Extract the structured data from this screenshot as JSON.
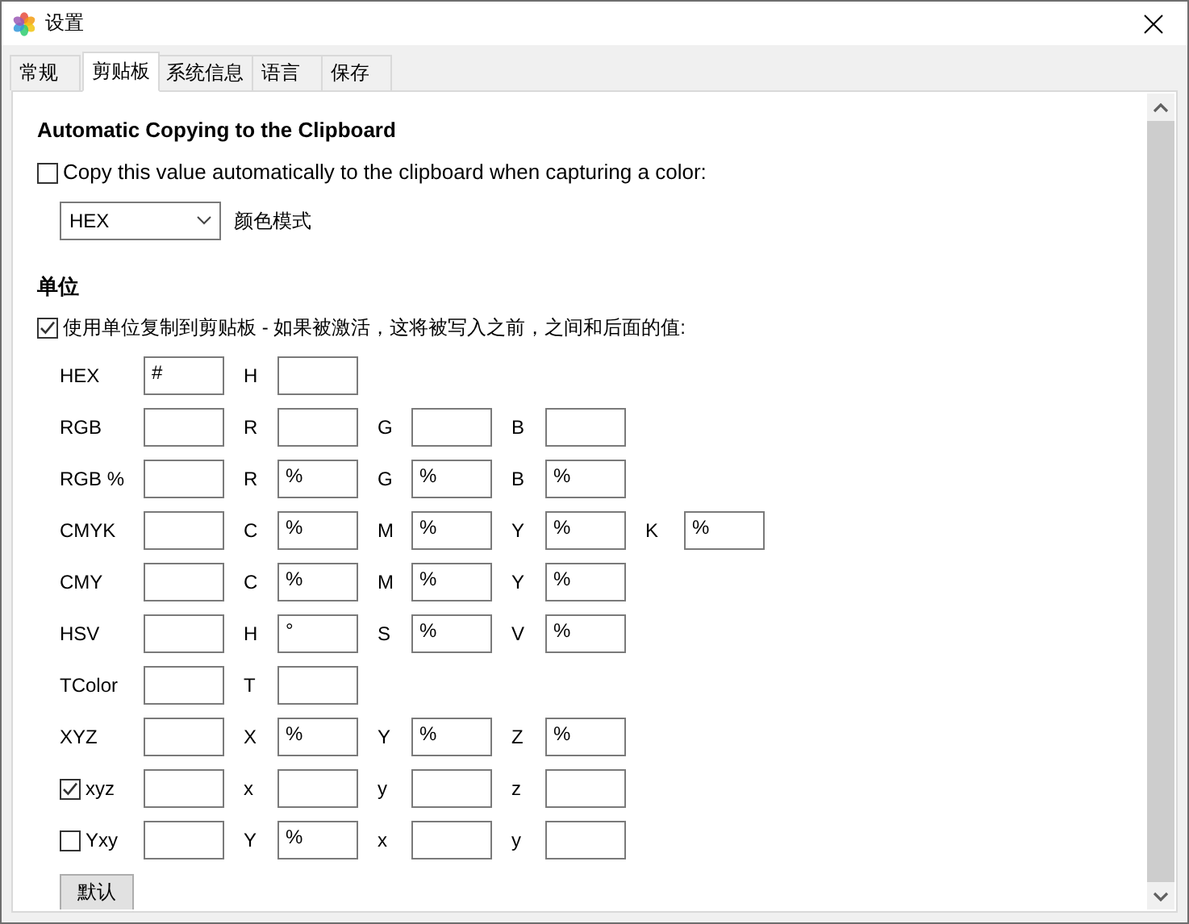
{
  "window": {
    "title": "设置"
  },
  "tabs": [
    {
      "label": "常规",
      "selected": false
    },
    {
      "label": "剪贴板",
      "selected": true
    },
    {
      "label": "系统信息",
      "selected": false
    },
    {
      "label": "语言",
      "selected": false
    },
    {
      "label": "保存",
      "selected": false
    }
  ],
  "auto_copy": {
    "heading": "Automatic Copying to the Clipboard",
    "checkbox": {
      "label": "Copy this value automatically to the clipboard when capturing a color:",
      "checked": false
    },
    "mode_select": {
      "value": "HEX"
    },
    "mode_label": "颜色模式"
  },
  "units": {
    "heading": "单位",
    "checkbox": {
      "label": "使用单位复制到剪贴板 - 如果被激活，这将被写入之前，之间和后面的值:",
      "checked": true
    },
    "rows": [
      {
        "kind": "label",
        "label": "HEX",
        "value": "#",
        "parts": [
          {
            "label": "H"
          }
        ]
      },
      {
        "kind": "label",
        "label": "RGB",
        "parts": [
          {
            "label": "R"
          },
          {
            "label": "G"
          },
          {
            "label": "B"
          }
        ]
      },
      {
        "kind": "label",
        "label": "RGB %",
        "parts": [
          {
            "label": "R",
            "value": "%"
          },
          {
            "label": "G",
            "value": "%"
          },
          {
            "label": "B",
            "value": "%"
          }
        ]
      },
      {
        "kind": "label",
        "label": "CMYK",
        "parts": [
          {
            "label": "C",
            "value": "%"
          },
          {
            "label": "M",
            "value": "%"
          },
          {
            "label": "Y",
            "value": "%"
          },
          {
            "label": "K",
            "value": "%"
          }
        ]
      },
      {
        "kind": "label",
        "label": "CMY",
        "parts": [
          {
            "label": "C",
            "value": "%"
          },
          {
            "label": "M",
            "value": "%"
          },
          {
            "label": "Y",
            "value": "%"
          }
        ]
      },
      {
        "kind": "label",
        "label": "HSV",
        "parts": [
          {
            "label": "H",
            "value": "°"
          },
          {
            "label": "S",
            "value": "%"
          },
          {
            "label": "V",
            "value": "%"
          }
        ]
      },
      {
        "kind": "label",
        "label": "TColor",
        "parts": [
          {
            "label": "T"
          }
        ]
      },
      {
        "kind": "label",
        "label": "XYZ",
        "parts": [
          {
            "label": "X",
            "value": "%"
          },
          {
            "label": "Y",
            "value": "%"
          },
          {
            "label": "Z",
            "value": "%"
          }
        ]
      },
      {
        "kind": "checkbox",
        "label": "xyz",
        "checked": true,
        "parts": [
          {
            "label": "x"
          },
          {
            "label": "y"
          },
          {
            "label": "z"
          }
        ]
      },
      {
        "kind": "checkbox",
        "label": "Yxy",
        "checked": false,
        "parts": [
          {
            "label": "Y",
            "value": "%"
          },
          {
            "label": "x"
          },
          {
            "label": "y"
          }
        ]
      }
    ]
  },
  "default_button": "默认"
}
